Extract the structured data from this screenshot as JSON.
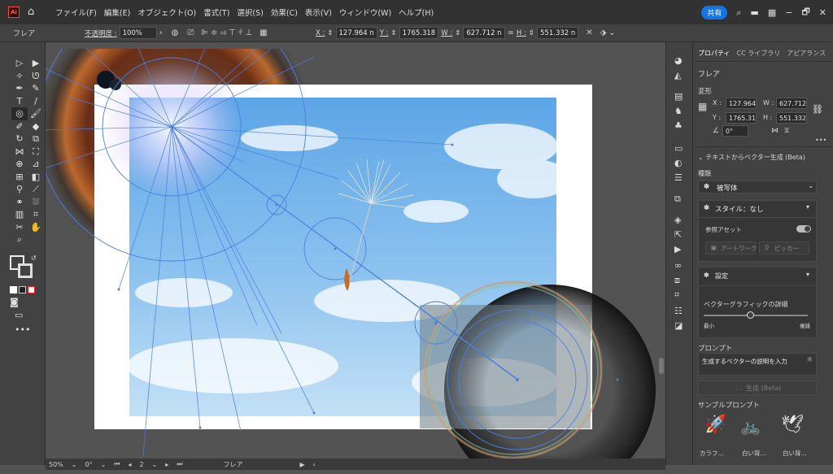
{
  "menubar": {
    "app_icon": "Ai",
    "items": [
      "ファイル(F)",
      "編集(E)",
      "オブジェクト(O)",
      "書式(T)",
      "選択(S)",
      "効果(C)",
      "表示(V)",
      "ウィンドウ(W)",
      "ヘルプ(H)"
    ],
    "share_label": "共有",
    "window_controls": [
      "−",
      "🗗",
      "✕"
    ]
  },
  "controlbar": {
    "selection_label": "フレア",
    "opacity_label": "不透明度 :",
    "opacity_value": "100%",
    "x_label": "X :",
    "x_value": "127.964 n",
    "y_label": "Y :",
    "y_value": "1765.318",
    "w_label": "W :",
    "w_value": "627.712 n",
    "h_label": "H :",
    "h_value": "551.332 n"
  },
  "statusbar": {
    "zoom": "50%",
    "rotation": "0°",
    "artboard": "2",
    "tool_name": "フレア"
  },
  "panel": {
    "tabs": [
      "プロパティ",
      "CC ライブラリ",
      "アピアランス"
    ],
    "object_type": "フレア",
    "transform_title": "変形",
    "x_label": "X :",
    "x_value": "127.964",
    "y_label": "Y :",
    "y_value": "1765.31",
    "w_label": "W :",
    "w_value": "627.712",
    "h_label": "H :",
    "h_value": "551.332",
    "angle_value": "0°",
    "more": "•••",
    "text_to_vector_title": "テキストからベクター生成 (Beta)",
    "type_label": "種類",
    "type_value": "被写体",
    "style_label": "スタイル：なし",
    "reference_asset_label": "参照アセット",
    "artwork_label": "アートワーク",
    "picker_label": "ピッカー",
    "settings_label": "設定",
    "detail_label": "ベクターグラフィックの詳細",
    "detail_min": "最小",
    "detail_max": "複雑",
    "detail_value": 0.45,
    "prompt_title": "プロンプト",
    "prompt_placeholder": "生成するベクターの説明を入力",
    "generate_label": "生成 (Beta)",
    "sample_title": "サンプルプロンプト",
    "samples": [
      "カラフ...",
      "白い背...",
      "白い背..."
    ]
  },
  "colors": {
    "accent": "#1473e6",
    "sky_top": "#6aaee6",
    "sky_bottom": "#b9dbf3",
    "flare_line": "#4f7fe0"
  }
}
